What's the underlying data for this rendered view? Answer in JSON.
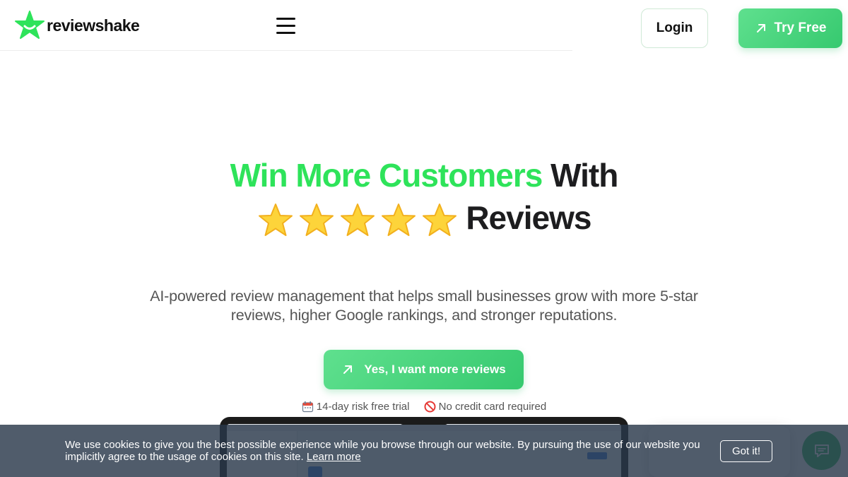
{
  "header": {
    "logo_text": "reviewshake",
    "login_label": "Login",
    "try_label": "Try Free"
  },
  "hero": {
    "headline_green": "Win More Customers",
    "headline_dark": "With",
    "headline_line2": "Reviews",
    "star_count": 5,
    "subtext": "AI-powered review management that helps small businesses grow with more 5-star reviews, higher Google rankings, and stronger reputations.",
    "cta_label": "Yes, I want more reviews",
    "badges": [
      {
        "icon": "calendar-icon",
        "text": "14-day risk free trial"
      },
      {
        "icon": "no-entry-icon",
        "text": "No credit card required"
      }
    ]
  },
  "cookie": {
    "text": "We use cookies to give you the best possible experience while you browse through our website. By pursuing the use of our website you implicitly agree to the usage of cookies on this site.",
    "link_label": "Learn more",
    "button_label": "Got it!"
  },
  "icons": {
    "logo": "star-logo-icon",
    "menu": "hamburger-menu-icon",
    "arrow": "arrow-up-right-icon",
    "chat": "chat-icon"
  },
  "colors": {
    "brand_green": "#2ee35a",
    "button_green": "#3fd374",
    "cookie_bg": "#2a384a",
    "text_dark": "#1d1d1f"
  }
}
